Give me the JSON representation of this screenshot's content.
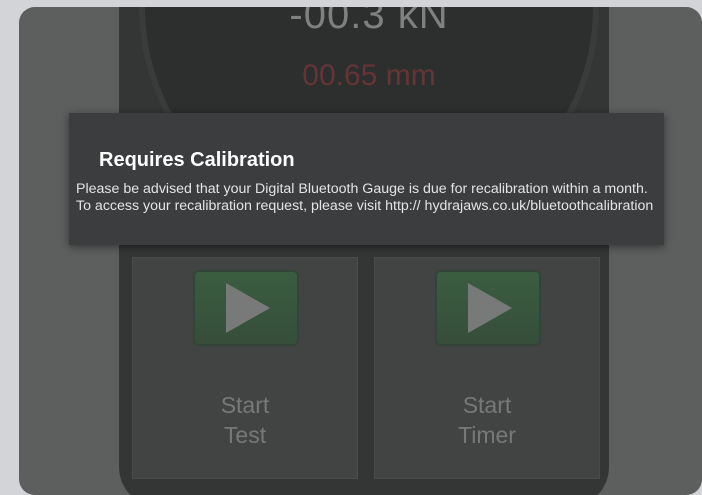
{
  "gauge": {
    "force_reading": "-00.3 kN",
    "distance_reading": "00.65 mm"
  },
  "buttons": {
    "start_test": {
      "line1": "Start",
      "line2": "Test",
      "icon": "play-icon"
    },
    "start_timer": {
      "line1": "Start",
      "line2": "Timer",
      "icon": "play-icon"
    }
  },
  "dialog": {
    "title": "Requires Calibration",
    "message": "Please be advised that your Digital Bluetooth Gauge is due for recalibration within a month. To access your recalibration request, please visit http:// hydrajaws.co.uk/bluetoothcalibration"
  },
  "colors": {
    "background": "#d2d4d7",
    "dialog_bg": "#3b3d3e",
    "distance_text": "#6a1212",
    "play_green": "#1d5a26"
  }
}
